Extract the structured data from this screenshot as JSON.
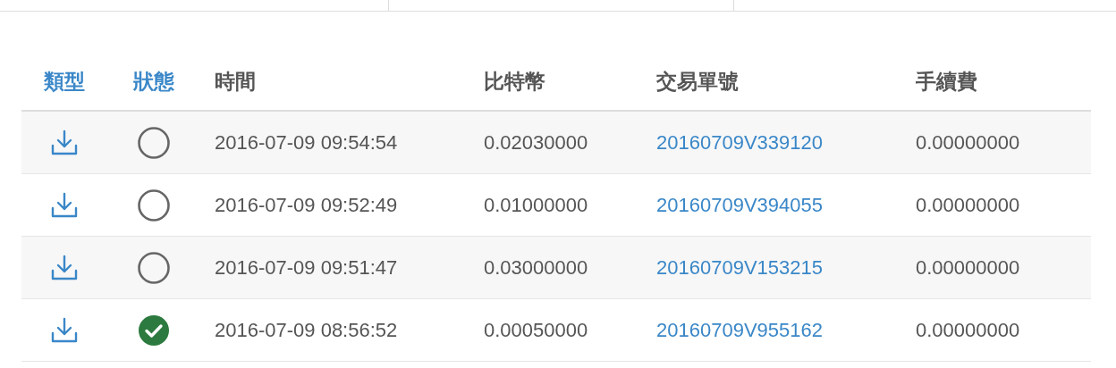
{
  "table": {
    "columns": [
      {
        "label": "類型",
        "link": true
      },
      {
        "label": "狀態",
        "link": true
      },
      {
        "label": "時間",
        "link": false
      },
      {
        "label": "比特幣",
        "link": false
      },
      {
        "label": "交易單號",
        "link": false
      },
      {
        "label": "手續費",
        "link": false
      }
    ],
    "rows": [
      {
        "completed": false,
        "time": "2016-07-09 09:54:54",
        "btc": "0.02030000",
        "txid": "20160709V339120",
        "fee": "0.00000000"
      },
      {
        "completed": false,
        "time": "2016-07-09 09:52:49",
        "btc": "0.01000000",
        "txid": "20160709V394055",
        "fee": "0.00000000"
      },
      {
        "completed": false,
        "time": "2016-07-09 09:51:47",
        "btc": "0.03000000",
        "txid": "20160709V153215",
        "fee": "0.00000000"
      },
      {
        "completed": true,
        "time": "2016-07-09 08:56:52",
        "btc": "0.00050000",
        "txid": "20160709V955162",
        "fee": "0.00000000"
      }
    ]
  }
}
